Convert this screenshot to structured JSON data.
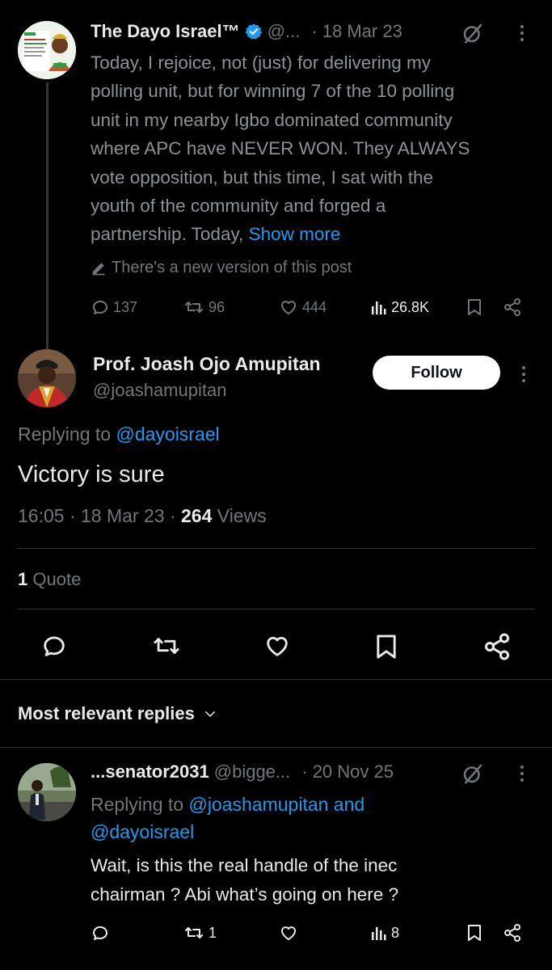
{
  "colors": {
    "background": "#000000",
    "text": "#e7e9ea",
    "muted": "#71767b",
    "link": "#1d9bf0",
    "verified": "#1d9bf0",
    "divider": "#2f3336"
  },
  "parent_tweet": {
    "display_name": "The Dayo Israel™",
    "handle_truncated": "@...",
    "date": "· 18 Mar 23",
    "text_lines": [
      "Today, I rejoice, not (just) for delivering my",
      "polling unit, but for winning 7 of the 10 polling",
      "unit in my nearby Igbo dominated community",
      "where APC have NEVER WON. They ALWAYS",
      "vote opposition, but this time, I sat with the",
      "youth of the community and forged a"
    ],
    "last_line": "partnership. Today,",
    "show_more": "Show more",
    "edited_notice": "There's a new version of this post",
    "stats": {
      "replies": "137",
      "reposts": "96",
      "likes": "444",
      "views": "26.8K"
    },
    "icons": [
      "verified-badge-icon",
      "grok-icon",
      "more-icon",
      "edit-pencil-icon",
      "reply-icon",
      "repost-icon",
      "like-icon",
      "views-icon",
      "bookmark-icon",
      "share-icon"
    ]
  },
  "main_tweet": {
    "display_name": "Prof. Joash Ojo Amupitan",
    "handle": "@joashamupitan",
    "follow_label": "Follow",
    "replying_prefix": "Replying to",
    "replying_to": "@dayoisrael",
    "text": "Victory is sure",
    "time": "16:05 · 18 Mar 23 ·",
    "views_count": "264",
    "views_label": "Views",
    "quote_count": "1",
    "quote_label": "Quote"
  },
  "replies_header": "Most relevant replies",
  "reply": {
    "display_name": "...senator2031",
    "handle_truncated": "@bigge...",
    "date": "· 20 Nov 25",
    "replying_prefix": "Replying to",
    "replying_to": "@joashamupitan and",
    "replying_to_2": "@dayoisrael",
    "text_lines": [
      "Wait, is this the real handle of the inec",
      "chairman ? Abi what’s going on here ?"
    ],
    "stats": {
      "replies": "",
      "reposts": "1",
      "likes": "",
      "views": "8"
    }
  }
}
